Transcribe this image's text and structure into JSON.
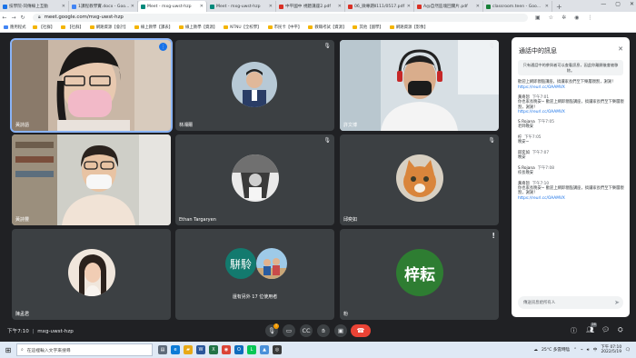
{
  "browser": {
    "tabs": [
      {
        "title": "技學院-同傳線上互動",
        "color": "#1a73e8"
      },
      {
        "title": "1課程教學實.docx - Goo...",
        "color": "#4285f4"
      },
      {
        "title": "Meet - mxg-uwst-hzp",
        "color": "#00897b",
        "active": true
      },
      {
        "title": "Meet - mxg-uwst-hzp",
        "color": "#00897b"
      },
      {
        "title": "中平國中 視聽講座2.pdf",
        "color": "#d93025"
      },
      {
        "title": "06_微專題Ⅱ111/0517.pdf",
        "color": "#d93025"
      },
      {
        "title": "A@自然區塊回實片.pdf",
        "color": "#d93025"
      },
      {
        "title": "classroom.teen - Goo...",
        "color": "#188038"
      }
    ],
    "url": "meet.google.com/mxg-uwst-hzp",
    "bookmarks": [
      "應用程式",
      "【社群】",
      "【社群】",
      "網路資源【會計】",
      "線上教學【課表】",
      "線上教學【資源】",
      "NTNU【全校學】",
      "市民卡【中平】",
      "教職考試【資源】",
      "其他【國學】",
      "網路資源【影像】"
    ]
  },
  "tiles": [
    {
      "name": "黃詩語",
      "type": "video",
      "active": true
    },
    {
      "name": "林湘爾",
      "type": "avatar"
    },
    {
      "name": "許文博",
      "type": "video"
    },
    {
      "name": "黃詩豐",
      "type": "video"
    },
    {
      "name": "Ethan Targaryen",
      "type": "avatar"
    },
    {
      "name": "邱奕如",
      "type": "avatar"
    },
    {
      "name": "陳孟君",
      "type": "avatar"
    },
    {
      "name": "還有另外 17 位使用者",
      "type": "group",
      "group_initial": "駢駖"
    },
    {
      "name": "粉",
      "type": "initials",
      "initials": "梓耘",
      "color": "#2e7d32"
    }
  ],
  "chat": {
    "title": "通話中的訊息",
    "note": "只有通話中的參與者可以查看訊息，因此你離開後會被移除。",
    "messages": [
      {
        "who": "",
        "time": "",
        "text": "歡迎上網即親臨講座，搞讓家長們至下樂層親割，謝謝！",
        "link": "https://reurl.cc/OAAMVX"
      },
      {
        "who": "黃奇恕",
        "time": "下午7:01",
        "text": "你也家長晚安~ 歡迎上網即親臨講座，搞讓家長們至下樂層親割，謝謝！",
        "link": "https://reurl.cc/OAAMVX"
      },
      {
        "who": "S Rojana",
        "time": "下午7:05",
        "text": "老師晚安",
        "link": ""
      },
      {
        "who": "柠",
        "time": "下午7:05",
        "text": "晚安~",
        "link": ""
      },
      {
        "who": "邱奕如",
        "time": "下午7:07",
        "text": "晚安",
        "link": ""
      },
      {
        "who": "S Rojana",
        "time": "下午7:08",
        "text": "校長晚安",
        "link": ""
      },
      {
        "who": "黃奇恕",
        "time": "下午7:10",
        "text": "你也家長晚安~ 歡迎上網即親臨講座，搞讓家長們至下樂層親割，謝謝！",
        "link": "https://reurl.cc/OAAMVX"
      }
    ],
    "input_placeholder": "傳送訊息給所有人"
  },
  "controls": {
    "time": "下午7:10",
    "meeting_code": "mxg-uwst-hzp",
    "participants_badge": "26"
  },
  "taskbar": {
    "search_placeholder": "在這裡輸入文字來搜尋",
    "weather": "25°C 多雲時陰",
    "time": "下午 07:10",
    "date": "2022/5/19"
  }
}
